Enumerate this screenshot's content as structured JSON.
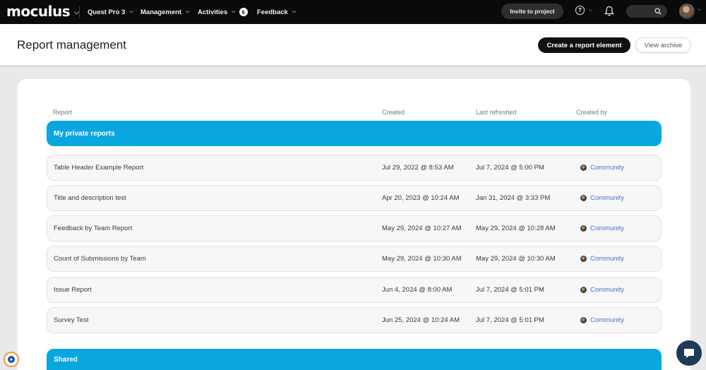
{
  "nav": {
    "logo": "moculus",
    "project": "Quest Pro 3",
    "management": "Management",
    "activities": "Activities",
    "activities_badge": "5",
    "feedback": "Feedback",
    "invite": "Invite to project",
    "help_glyph": "?"
  },
  "header": {
    "title": "Report management",
    "create_label": "Create a report element",
    "archive_label": "View archive"
  },
  "table": {
    "columns": [
      "Report",
      "Created",
      "Last refreshed",
      "Created by"
    ],
    "groups": [
      {
        "label": "My private reports",
        "rows": [
          {
            "name": "Table Header Example Report",
            "created": "Jul 29, 2022 @ 8:53 AM",
            "refreshed": "Jul 7, 2024 @ 5:00 PM",
            "by": "Community"
          },
          {
            "name": "Title and description test",
            "created": "Apr 20, 2023 @ 10:24 AM",
            "refreshed": "Jan 31, 2024 @ 3:33 PM",
            "by": "Community"
          },
          {
            "name": "Feedback by Team Report",
            "created": "May 29, 2024 @ 10:27 AM",
            "refreshed": "May 29, 2024 @ 10:28 AM",
            "by": "Community"
          },
          {
            "name": "Count of Submissions by Team",
            "created": "May 29, 2024 @ 10:30 AM",
            "refreshed": "May 29, 2024 @ 10:30 AM",
            "by": "Community"
          },
          {
            "name": "Issue Report",
            "created": "Jun 4, 2024 @ 8:00 AM",
            "refreshed": "Jul 7, 2024 @ 5:01 PM",
            "by": "Community"
          },
          {
            "name": "Survey Test",
            "created": "Jun 25, 2024 @ 10:24 AM",
            "refreshed": "Jul 7, 2024 @ 5:01 PM",
            "by": "Community"
          }
        ]
      },
      {
        "label": "Shared",
        "rows": []
      }
    ]
  },
  "icons": [
    "chevron-down-icon",
    "help-icon",
    "bell-icon",
    "search-icon",
    "avatar",
    "chat-icon",
    "corner-app-icon"
  ],
  "colors": {
    "accent": "#0aa6df",
    "link": "#4f6fcc",
    "nav_bg": "#0a0a0a"
  }
}
